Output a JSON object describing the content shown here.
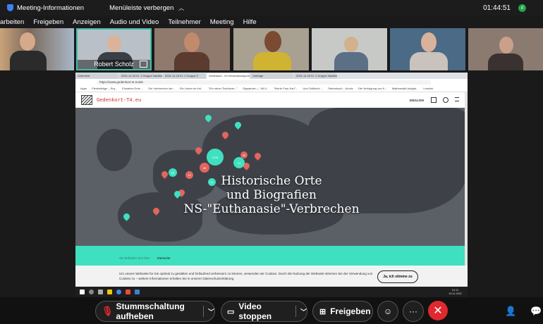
{
  "topbar": {
    "meeting_info": "Meeting-Informationen",
    "hide_menu": "Menüleiste verbergen",
    "time": "01:44:51",
    "signal": "ıl"
  },
  "menubar": [
    "arbeiten",
    "Freigeben",
    "Anzeigen",
    "Audio und Video",
    "Teilnehmer",
    "Meeting",
    "Hilfe"
  ],
  "participants": {
    "active_name": "Robert Scholz"
  },
  "browser": {
    "tabs": [
      "Unterricht",
      "2021-11-19 Kl. 1 Gruppe Nachbereitung",
      "2021-11-19 Kl. 1 Gruppe 2",
      "Gedenkort - Ihr Informationsportal",
      "Umfrage",
      "2021-11-19 Kl. 1 Gruppe Nachbereitung"
    ],
    "url": "https://www.gedenkort-t4.eu/de",
    "bookmarks": [
      "Apps",
      "Filmbeiträge – Erg...",
      "Einsteins Erde ...",
      "Die Verbrechen der...",
      "Ein Leben im Kel...",
      "\"Ein reiner Tischlerer...\"",
      "Signaturen — WLV...",
      "\"Werte Frau Karl\"...",
      "Und Ostflucht ...",
      "Sterbebuch – Archiv",
      "Die Verfolgung von K...",
      "Mathematik Aufgab...",
      "Leselist"
    ]
  },
  "site": {
    "logo_text": "Gedenkort-T4.eu",
    "language": "ENGLISH",
    "title_lines": [
      "Historische Orte",
      "und Biografien",
      "NS-\"Euthanasie\"-Verbrechen"
    ],
    "breadcrumb_here": "Sie befinden sich hier:",
    "breadcrumb_page": "Startseite",
    "clusters": [
      "1415",
      "41",
      "45",
      "40",
      "23",
      "14",
      "21"
    ],
    "cookie_text": "Um unsere Webseite für Sie optimal zu gestalten und fortlaufend verbessern zu können, verwenden wir Cookies. Durch die Nutzung der Webseite stimmen Sie der Verwendung von Cookies zu – weitere Informationen erhalten Sie in unserer Datenschutzerklärung.",
    "cookie_button": "Ja, ich stimme zu",
    "clock_time": "01:11",
    "clock_date": "19.11.2021"
  },
  "controls": {
    "mute_label": "Stummschaltung aufheben",
    "video_label": "Video stoppen",
    "share_label": "Freigeben"
  },
  "colors": {
    "accent_mint": "#3fe0c0",
    "marker_red": "#e2655f",
    "end_red": "#e0282e"
  }
}
